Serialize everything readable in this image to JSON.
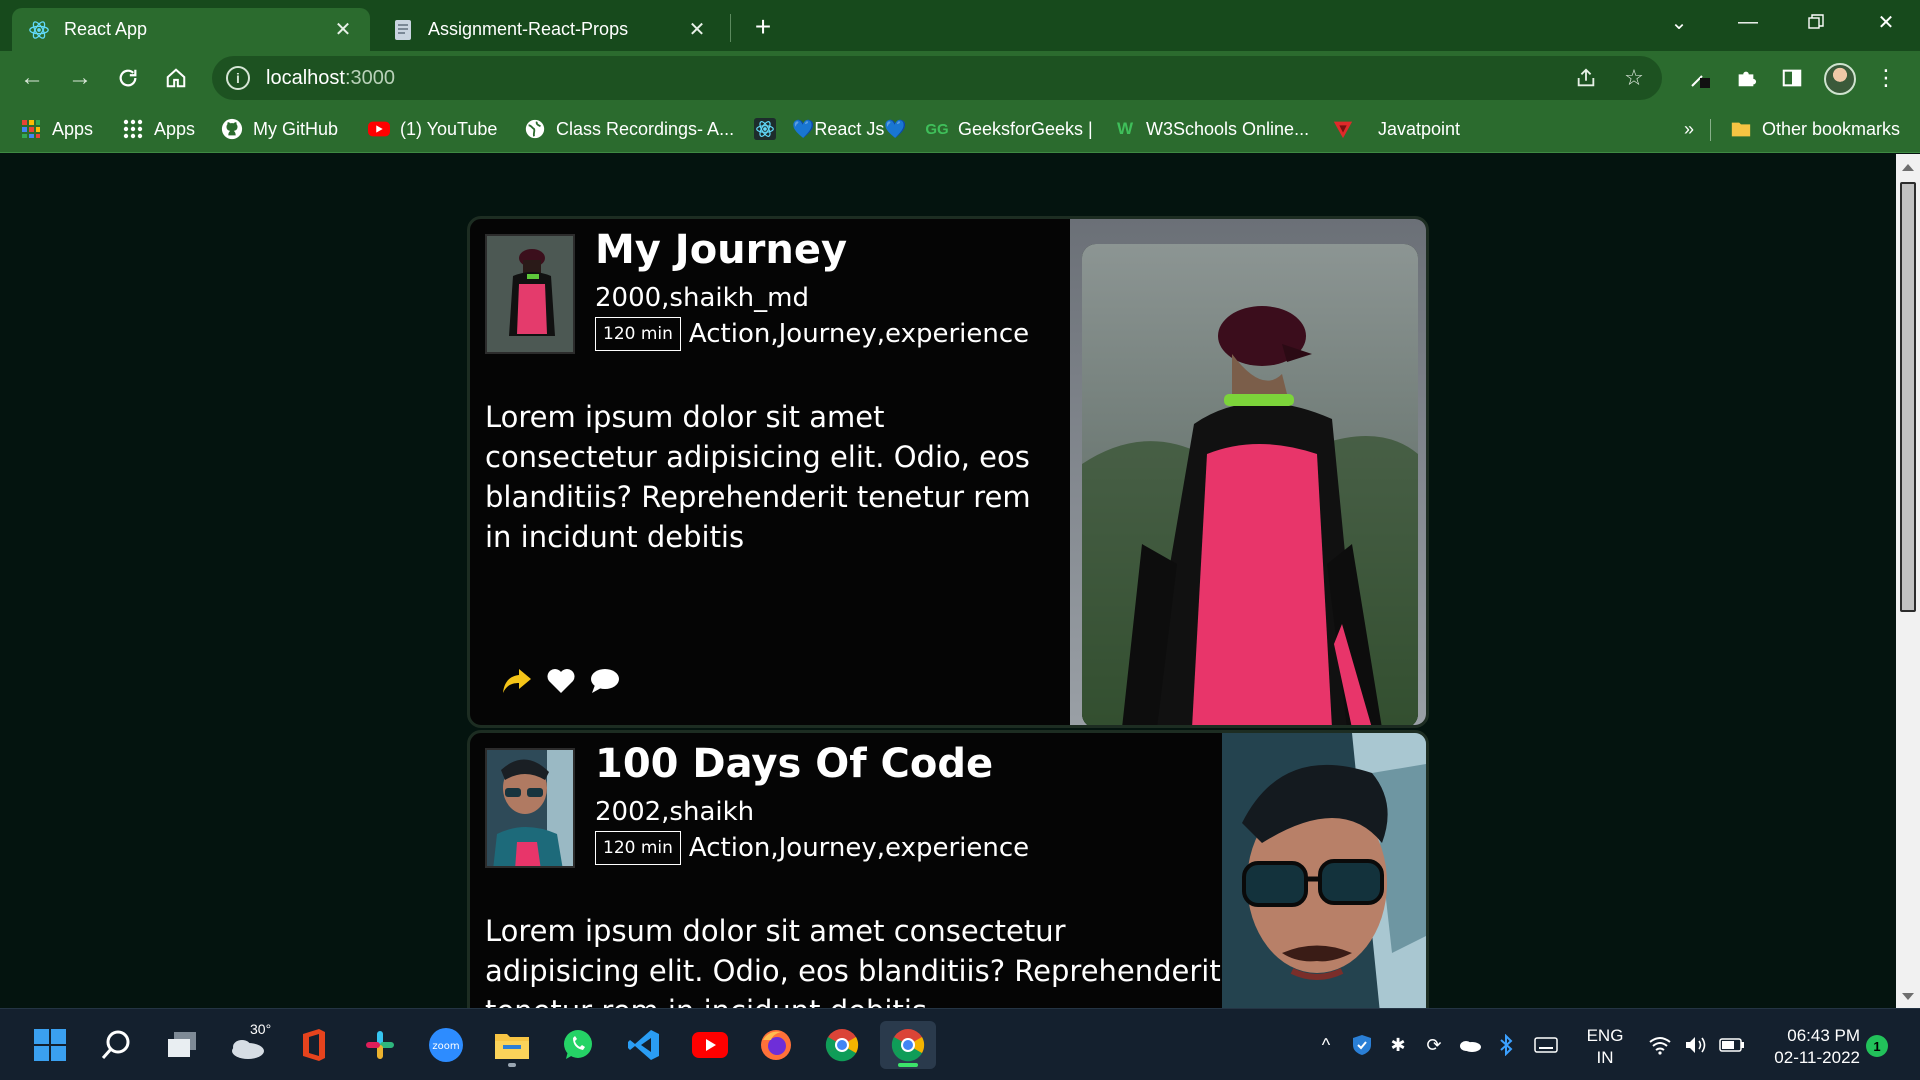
{
  "browser": {
    "tabs": [
      {
        "title": "React App",
        "icon": "react-icon"
      },
      {
        "title": "Assignment-React-Props",
        "icon": "document-icon"
      }
    ],
    "address": {
      "host": "localhost",
      "port": ":3000"
    },
    "bookmarks": [
      {
        "label": "Apps",
        "icon": "apps-grid-icon"
      },
      {
        "label": "Apps",
        "icon": "apps-dots-icon"
      },
      {
        "label": "My GitHub",
        "icon": "github-icon"
      },
      {
        "label": "(1) YouTube",
        "icon": "youtube-icon"
      },
      {
        "label": "Class Recordings- A...",
        "icon": "globe-icon"
      },
      {
        "label": "",
        "icon": "react-icon"
      },
      {
        "label": "💙React Js💙",
        "icon": ""
      },
      {
        "label": "GeeksforGeeks |",
        "icon": "geeksforgeeks-icon"
      },
      {
        "label": "W3Schools Online...",
        "icon": "w3schools-icon"
      },
      {
        "label": "Javatpoint",
        "icon": "javatpoint-icon"
      }
    ],
    "overflow_label": "»",
    "other_bookmarks": "Other bookmarks",
    "accent_color": "#2b6b2e"
  },
  "cards": [
    {
      "title": "My Journey",
      "subtitle": "2000,shaikh_md",
      "runtime": "120 min",
      "genres": "Action,Journey,experience",
      "description": "Lorem ipsum dolor sit amet consectetur adipisicing elit. Odio, eos blanditiis? Reprehenderit tenetur rem in incidunt debitis",
      "actions": [
        "share-icon",
        "heart-icon",
        "comment-icon"
      ]
    },
    {
      "title": "100 Days Of Code",
      "subtitle": "2002,shaikh",
      "runtime": "120 min",
      "genres": "Action,Journey,experience",
      "description": "Lorem ipsum dolor sit amet consectetur adipisicing elit. Odio, eos blanditiis? Reprehenderit tenetur rem in incidunt debitis"
    }
  ],
  "taskbar": {
    "weather_temp": "30°",
    "lang_top": "ENG",
    "lang_bottom": "IN",
    "time": "06:43 PM",
    "date": "02-11-2022",
    "notifications": "1"
  }
}
